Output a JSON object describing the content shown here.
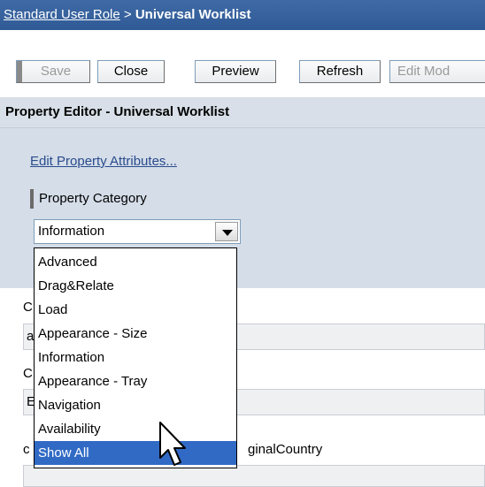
{
  "breadcrumb": {
    "parent": "Standard User Role",
    "separator": " > ",
    "current": "Universal Worklist"
  },
  "toolbar": {
    "save": "Save",
    "close": "Close",
    "preview": "Preview",
    "refresh": "Refresh",
    "edit_mode": "Edit Mod"
  },
  "editor": {
    "title": "Property Editor - Universal Worklist",
    "edit_attributes_link": "Edit Property Attributes...",
    "category_label": "Property Category",
    "category_value": "Information"
  },
  "dropdown": {
    "options": [
      "Advanced",
      "Drag&Relate",
      "Load",
      "Appearance - Size",
      "Information",
      "Appearance - Tray",
      "Navigation",
      "Availability",
      "Show All"
    ],
    "selected": "Show All"
  },
  "lower": {
    "row1_label_fragment": "C",
    "row1_value_fragment": "a",
    "row2_label_fragment": "C",
    "row2_value_fragment": "E",
    "row3_label_fragment": "c",
    "row3_label_suffix": "ginalCountry"
  },
  "colors": {
    "titlebar": "#2f5a96",
    "panel": "#d4dde8",
    "selection": "#316ac5",
    "link": "#2a4b8d"
  }
}
